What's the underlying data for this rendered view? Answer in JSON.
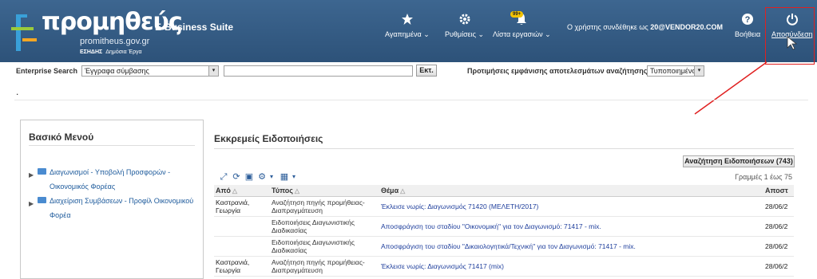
{
  "header": {
    "logo_main": "προμηθεύς",
    "logo_sub": "promitheus.gov.gr",
    "logo_tag_bold": "ΕΣΗΔΗΣ",
    "logo_tag": "Δημόσια Έργα",
    "suite": "E-Business Suite",
    "favorites": "Αγαπημένα",
    "settings": "Ρυθμίσεις",
    "worklist": "Λίστα εργασιών",
    "worklist_badge": "99+",
    "user_prefix": "Ο χρήστης συνδέθηκε ως",
    "user_name": "20@VENDOR20.COM",
    "help": "Βοήθεια",
    "logout": "Αποσύνδεση"
  },
  "search": {
    "label": "Enterprise Search",
    "scope": "Έγγραφα σύμβασης",
    "query": "",
    "go": "Εκτ.",
    "pref_label": "Προτιμήσεις εμφάνισης αποτελεσμάτων αναζήτησης",
    "pref_value": "Τυποποιημένο"
  },
  "dot": ".",
  "menu": {
    "title": "Βασικό Μενού",
    "items": [
      {
        "line1": "Διαγωνισμοί - Υποβολή Προσφορών -",
        "line2": "Οικονομικός Φορέας"
      },
      {
        "line1": "Διαχείριση Συμβάσεων - Προφίλ Οικονομικού",
        "line2": "Φορέα"
      }
    ]
  },
  "notifications": {
    "title": "Εκκρεμείς Ειδοποιήσεις",
    "search_button": "Αναζήτηση Ειδοποιήσεων (743)",
    "rows_count": "Γραμμές 1 έως 75",
    "columns": [
      "Από",
      "Τύπος",
      "Θέμα",
      "Αποστ"
    ],
    "rows": [
      {
        "from": "Καστρανιά, Γεωργία",
        "type": "Αναζήτηση πηγής προμήθειας-Διαπραγμάτευση",
        "subject": "Έκλεισε νωρίς: Διαγωνισμός 71420 (ΜΕΛΕΤΗ/2017)",
        "date": "28/06/2"
      },
      {
        "from": "",
        "type": "Ειδοποιήσεις Διαγωνιστικής Διαδικασίας",
        "subject": "Αποσφράγιση του σταδίου \"Οικονομική\" για τον Διαγωνισμό: 71417 - mix.",
        "date": "28/06/2"
      },
      {
        "from": "",
        "type": "Ειδοποιήσεις Διαγωνιστικής Διαδικασίας",
        "subject": "Αποσφράγιση του σταδίου \"Δικαιολογητικά/Τεχνική\" για τον Διαγωνισμό: 71417 - mix.",
        "date": "28/06/2"
      },
      {
        "from": "Καστρανιά, Γεωργία",
        "type": "Αναζήτηση πηγής προμήθειας-Διαπραγμάτευση",
        "subject": "Έκλεισε νωρίς: Διαγωνισμός 71417 (mix)",
        "date": "28/06/2"
      }
    ]
  },
  "colors": {
    "header": "#2d5279",
    "link": "#1e5b9c",
    "highlight": "#e02020",
    "badge": "#f3c300"
  }
}
